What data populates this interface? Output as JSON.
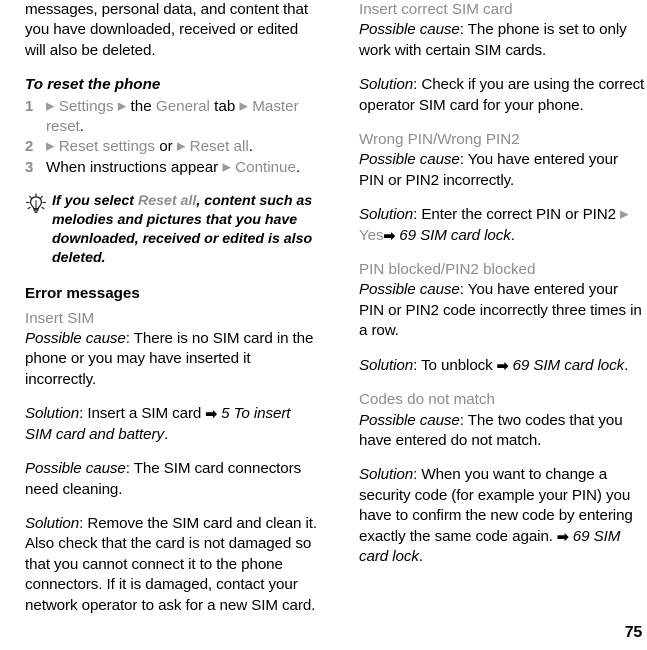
{
  "page": {
    "number": "75",
    "columns": 2
  },
  "colors": {
    "text": "#000000",
    "grey": "#8c8c8c",
    "background": "#ffffff"
  },
  "icons": {
    "tip_bulb": "lightbulb-icon",
    "menu_arrow": "▶",
    "page_ref_arrow": "➡"
  },
  "left_column": {
    "continued_paragraph": "messages, personal data, and content that you have downloaded, received or edited will also be deleted.",
    "procedure": {
      "heading": "To reset the phone",
      "steps": [
        {
          "number": "1",
          "parts": [
            {
              "text": "▶",
              "style": "menu-arrow"
            },
            {
              "text": "Settings",
              "style": "grey"
            },
            {
              "text": "▶",
              "style": "menu-arrow"
            },
            {
              "text": "the",
              "style": "black"
            },
            {
              "text": "General",
              "style": "grey"
            },
            {
              "text": "tab",
              "style": "black"
            },
            {
              "text": "▶",
              "style": "menu-arrow"
            },
            {
              "text": "Master reset",
              "style": "grey"
            },
            {
              "text": ".",
              "style": "black"
            }
          ]
        },
        {
          "number": "2",
          "parts": [
            {
              "text": "▶",
              "style": "menu-arrow"
            },
            {
              "text": "Reset settings",
              "style": "grey"
            },
            {
              "text": "or",
              "style": "black"
            },
            {
              "text": "▶",
              "style": "menu-arrow"
            },
            {
              "text": "Reset all",
              "style": "grey"
            },
            {
              "text": ".",
              "style": "black"
            }
          ]
        },
        {
          "number": "3",
          "parts": [
            {
              "text": "When instructions appear",
              "style": "black"
            },
            {
              "text": "▶",
              "style": "menu-arrow"
            },
            {
              "text": "Continue",
              "style": "grey"
            },
            {
              "text": ".",
              "style": "black"
            }
          ]
        }
      ]
    },
    "tip": {
      "icon": "lightbulb-icon",
      "lead": "If you select ",
      "highlight": "Reset all",
      "rest": ", content such as melodies and pictures that you have downloaded, received or edited is also deleted."
    },
    "error_messages_heading": "Error messages",
    "entries": [
      {
        "title": "Insert SIM",
        "blocks": [
          {
            "label": "Possible cause",
            "separator": ": ",
            "text": "There is no SIM card in the phone or you may have inserted it incorrectly."
          },
          {
            "label": "Solution",
            "separator": ": ",
            "text": "Insert a SIM card ",
            "ref_arrow": "➡",
            "ref": "5 To insert SIM card and battery",
            "trailing": "."
          },
          {
            "label": "Possible cause",
            "separator": ": ",
            "text": "The SIM card connectors need cleaning."
          },
          {
            "label": "Solution",
            "separator": ": ",
            "text": "Remove the SIM card and clean it. Also check that the card is not damaged so that you cannot connect it to the phone connectors. If it is damaged, contact your network operator to ask for a new SIM card."
          }
        ]
      }
    ]
  },
  "right_column": {
    "entries": [
      {
        "title": "Insert correct SIM card",
        "blocks": [
          {
            "label": "Possible cause",
            "separator": ": ",
            "text": "The phone is set to only work with certain SIM cards."
          },
          {
            "label": "Solution",
            "separator": ": ",
            "text": "Check if you are using the correct operator SIM card for your phone."
          }
        ]
      },
      {
        "title": "Wrong PIN/Wrong PIN2",
        "blocks": [
          {
            "label": "Possible cause",
            "separator": ": ",
            "text": "You have entered your PIN or PIN2 incorrectly."
          },
          {
            "label": "Solution",
            "separator": ": ",
            "text": "Enter the correct PIN or PIN2 ",
            "menu_arrow": "▶",
            "menu_item": "Yes",
            "ref_arrow": "➡",
            "ref": "69 SIM card lock",
            "trailing": "."
          }
        ]
      },
      {
        "title": "PIN blocked/PIN2 blocked",
        "blocks": [
          {
            "label": "Possible cause",
            "separator": ": ",
            "text": "You have entered your PIN or PIN2 code incorrectly three times in a row."
          },
          {
            "label": "Solution",
            "separator": ": ",
            "text": "To unblock ",
            "ref_arrow": "➡",
            "ref": "69 SIM card lock",
            "trailing": "."
          }
        ]
      },
      {
        "title": "Codes do not match",
        "blocks": [
          {
            "label": "Possible cause",
            "separator": ": ",
            "text": "The two codes that you have entered do not match."
          },
          {
            "label": "Solution",
            "separator": ": ",
            "text": "When you want to change a security code (for example your PIN) you have to confirm the new code by entering exactly the same code again. ",
            "ref_arrow": "➡",
            "ref": "69 SIM card lock",
            "trailing": "."
          }
        ]
      }
    ]
  }
}
